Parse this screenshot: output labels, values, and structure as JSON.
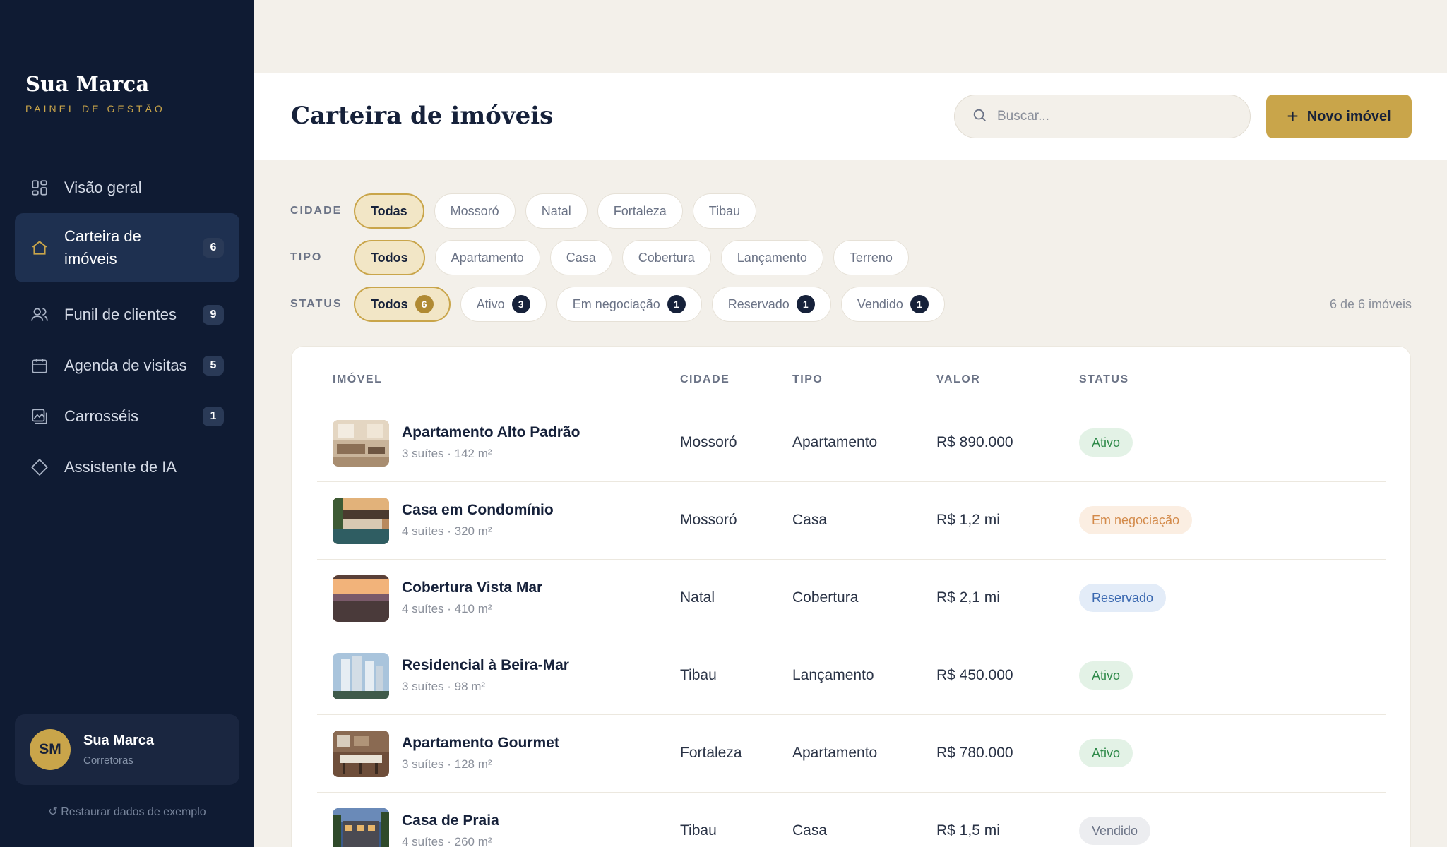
{
  "brand": {
    "name": "Sua Marca",
    "subtitle": "PAINEL DE GESTÃO"
  },
  "nav": [
    {
      "label": "Visão geral",
      "icon": "grid-icon",
      "badge": ""
    },
    {
      "label": "Carteira de imóveis",
      "icon": "home-icon",
      "badge": "6",
      "active": true
    },
    {
      "label": "Funil de clientes",
      "icon": "users-icon",
      "badge": "9"
    },
    {
      "label": "Agenda de visitas",
      "icon": "calendar-icon",
      "badge": "5"
    },
    {
      "label": "Carrosséis",
      "icon": "images-icon",
      "badge": "1"
    },
    {
      "label": "Assistente de IA",
      "icon": "diamond-icon",
      "badge": ""
    }
  ],
  "user": {
    "initials": "SM",
    "name": "Sua Marca",
    "role": "Corretoras"
  },
  "restore_label": "↺ Restaurar dados de exemplo",
  "header": {
    "title": "Carteira de imóveis",
    "search_placeholder": "Buscar...",
    "new_button": "Novo imóvel"
  },
  "filters": {
    "cidade": {
      "label": "CIDADE",
      "options": [
        "Todas",
        "Mossoró",
        "Natal",
        "Fortaleza",
        "Tibau"
      ]
    },
    "tipo": {
      "label": "TIPO",
      "options": [
        "Todos",
        "Apartamento",
        "Casa",
        "Cobertura",
        "Lançamento",
        "Terreno"
      ]
    },
    "status": {
      "label": "STATUS",
      "options": [
        {
          "label": "Todos",
          "count": "6"
        },
        {
          "label": "Ativo",
          "count": "3"
        },
        {
          "label": "Em negociação",
          "count": "1"
        },
        {
          "label": "Reservado",
          "count": "1"
        },
        {
          "label": "Vendido",
          "count": "1"
        }
      ]
    },
    "result_count": "6 de 6 imóveis"
  },
  "table": {
    "headers": {
      "imovel": "IMÓVEL",
      "cidade": "CIDADE",
      "tipo": "TIPO",
      "valor": "VALOR",
      "status": "STATUS"
    },
    "rows": [
      {
        "title": "Apartamento Alto Padrão",
        "sub": "3 suítes · 142 m²",
        "cidade": "Mossoró",
        "tipo": "Apartamento",
        "valor": "R$ 890.000",
        "status": "Ativo",
        "status_kind": "ativo"
      },
      {
        "title": "Casa em Condomínio",
        "sub": "4 suítes · 320 m²",
        "cidade": "Mossoró",
        "tipo": "Casa",
        "valor": "R$ 1,2 mi",
        "status": "Em negociação",
        "status_kind": "neg"
      },
      {
        "title": "Cobertura Vista Mar",
        "sub": "4 suítes · 410 m²",
        "cidade": "Natal",
        "tipo": "Cobertura",
        "valor": "R$ 2,1 mi",
        "status": "Reservado",
        "status_kind": "res"
      },
      {
        "title": "Residencial à Beira-Mar",
        "sub": "3 suítes · 98 m²",
        "cidade": "Tibau",
        "tipo": "Lançamento",
        "valor": "R$ 450.000",
        "status": "Ativo",
        "status_kind": "ativo"
      },
      {
        "title": "Apartamento Gourmet",
        "sub": "3 suítes · 128 m²",
        "cidade": "Fortaleza",
        "tipo": "Apartamento",
        "valor": "R$ 780.000",
        "status": "Ativo",
        "status_kind": "ativo"
      },
      {
        "title": "Casa de Praia",
        "sub": "4 suítes · 260 m²",
        "cidade": "Tibau",
        "tipo": "Casa",
        "valor": "R$ 1,5 mi",
        "status": "Vendido",
        "status_kind": "vend"
      }
    ]
  },
  "colors": {
    "sidebar": "#0f1b33",
    "accent": "#c9a54a",
    "background": "#f3f0ea"
  }
}
